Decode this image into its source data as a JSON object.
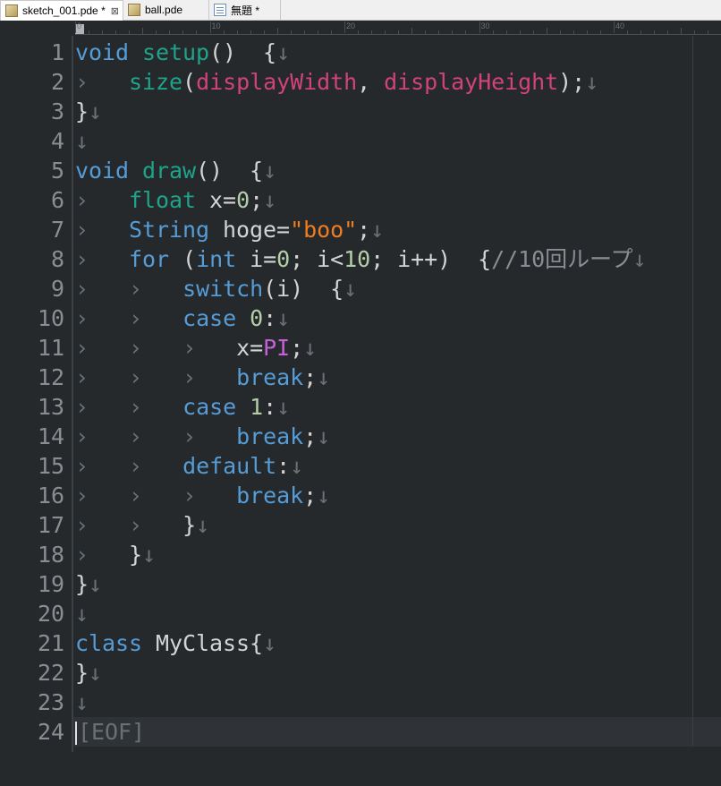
{
  "tabs": [
    {
      "label": "sketch_001.pde *",
      "icon": "pde-file-icon",
      "active": true,
      "close": "⊠"
    },
    {
      "label": "ball.pde",
      "icon": "pde-file-icon",
      "active": false
    },
    {
      "label": "無題 *",
      "icon": "text-file-icon",
      "active": false
    }
  ],
  "ruler": {
    "labels": [
      "0",
      "10",
      "20",
      "30",
      "40"
    ]
  },
  "marks": {
    "tab": "›",
    "newline": "↓",
    "eof": "[EOF]"
  },
  "lines": [
    {
      "n": "1",
      "tokens": [
        [
          "kw",
          "void"
        ],
        [
          "sym",
          " "
        ],
        [
          "fn",
          "setup"
        ],
        [
          "sym",
          "()  {"
        ]
      ],
      "nl": true
    },
    {
      "n": "2",
      "tokens": [
        [
          "tab",
          "›"
        ],
        [
          "sym",
          "   "
        ],
        [
          "fn",
          "size"
        ],
        [
          "sym",
          "("
        ],
        [
          "pink",
          "displayWidth"
        ],
        [
          "sym",
          ", "
        ],
        [
          "pink",
          "displayHeight"
        ],
        [
          "sym",
          ");"
        ]
      ],
      "nl": true
    },
    {
      "n": "3",
      "tokens": [
        [
          "sym",
          "}"
        ]
      ],
      "nl": true
    },
    {
      "n": "4",
      "tokens": [],
      "nl": true
    },
    {
      "n": "5",
      "tokens": [
        [
          "kw",
          "void"
        ],
        [
          "sym",
          " "
        ],
        [
          "fn",
          "draw"
        ],
        [
          "sym",
          "()  {"
        ]
      ],
      "nl": true
    },
    {
      "n": "6",
      "tokens": [
        [
          "tab",
          "›"
        ],
        [
          "sym",
          "   "
        ],
        [
          "type",
          "float"
        ],
        [
          "sym",
          " x="
        ],
        [
          "num",
          "0"
        ],
        [
          "sym",
          ";"
        ]
      ],
      "nl": true
    },
    {
      "n": "7",
      "tokens": [
        [
          "tab",
          "›"
        ],
        [
          "sym",
          "   "
        ],
        [
          "cls",
          "String"
        ],
        [
          "sym",
          " hoge="
        ],
        [
          "str",
          "\"boo\""
        ],
        [
          "sym",
          ";"
        ]
      ],
      "nl": true
    },
    {
      "n": "8",
      "tokens": [
        [
          "tab",
          "›"
        ],
        [
          "sym",
          "   "
        ],
        [
          "kw",
          "for"
        ],
        [
          "sym",
          " ("
        ],
        [
          "kw",
          "int"
        ],
        [
          "sym",
          " i="
        ],
        [
          "num",
          "0"
        ],
        [
          "sym",
          "; i<"
        ],
        [
          "num",
          "10"
        ],
        [
          "sym",
          "; i++)  {"
        ],
        [
          "cmt",
          "//10回ループ"
        ]
      ],
      "nl": true
    },
    {
      "n": "9",
      "tokens": [
        [
          "tab",
          "›"
        ],
        [
          "sym",
          "   "
        ],
        [
          "tab",
          "›"
        ],
        [
          "sym",
          "   "
        ],
        [
          "kw",
          "switch"
        ],
        [
          "sym",
          "(i)  {"
        ]
      ],
      "nl": true
    },
    {
      "n": "10",
      "tokens": [
        [
          "tab",
          "›"
        ],
        [
          "sym",
          "   "
        ],
        [
          "tab",
          "›"
        ],
        [
          "sym",
          "   "
        ],
        [
          "kw",
          "case"
        ],
        [
          "sym",
          " "
        ],
        [
          "num",
          "0"
        ],
        [
          "sym",
          ":"
        ]
      ],
      "nl": true
    },
    {
      "n": "11",
      "tokens": [
        [
          "tab",
          "›"
        ],
        [
          "sym",
          "   "
        ],
        [
          "tab",
          "›"
        ],
        [
          "sym",
          "   "
        ],
        [
          "tab",
          "›"
        ],
        [
          "sym",
          "   "
        ],
        [
          "sym",
          "x="
        ],
        [
          "const",
          "PI"
        ],
        [
          "sym",
          ";"
        ]
      ],
      "nl": true
    },
    {
      "n": "12",
      "tokens": [
        [
          "tab",
          "›"
        ],
        [
          "sym",
          "   "
        ],
        [
          "tab",
          "›"
        ],
        [
          "sym",
          "   "
        ],
        [
          "tab",
          "›"
        ],
        [
          "sym",
          "   "
        ],
        [
          "kw",
          "break"
        ],
        [
          "sym",
          ";"
        ]
      ],
      "nl": true
    },
    {
      "n": "13",
      "tokens": [
        [
          "tab",
          "›"
        ],
        [
          "sym",
          "   "
        ],
        [
          "tab",
          "›"
        ],
        [
          "sym",
          "   "
        ],
        [
          "kw",
          "case"
        ],
        [
          "sym",
          " "
        ],
        [
          "num",
          "1"
        ],
        [
          "sym",
          ":"
        ]
      ],
      "nl": true
    },
    {
      "n": "14",
      "tokens": [
        [
          "tab",
          "›"
        ],
        [
          "sym",
          "   "
        ],
        [
          "tab",
          "›"
        ],
        [
          "sym",
          "   "
        ],
        [
          "tab",
          "›"
        ],
        [
          "sym",
          "   "
        ],
        [
          "kw",
          "break"
        ],
        [
          "sym",
          ";"
        ]
      ],
      "nl": true
    },
    {
      "n": "15",
      "tokens": [
        [
          "tab",
          "›"
        ],
        [
          "sym",
          "   "
        ],
        [
          "tab",
          "›"
        ],
        [
          "sym",
          "   "
        ],
        [
          "kw",
          "default"
        ],
        [
          "sym",
          ":"
        ]
      ],
      "nl": true
    },
    {
      "n": "16",
      "tokens": [
        [
          "tab",
          "›"
        ],
        [
          "sym",
          "   "
        ],
        [
          "tab",
          "›"
        ],
        [
          "sym",
          "   "
        ],
        [
          "tab",
          "›"
        ],
        [
          "sym",
          "   "
        ],
        [
          "kw",
          "break"
        ],
        [
          "sym",
          ";"
        ]
      ],
      "nl": true
    },
    {
      "n": "17",
      "tokens": [
        [
          "tab",
          "›"
        ],
        [
          "sym",
          "   "
        ],
        [
          "tab",
          "›"
        ],
        [
          "sym",
          "   "
        ],
        [
          "sym",
          "}"
        ]
      ],
      "nl": true
    },
    {
      "n": "18",
      "tokens": [
        [
          "tab",
          "›"
        ],
        [
          "sym",
          "   "
        ],
        [
          "sym",
          "}"
        ]
      ],
      "nl": true
    },
    {
      "n": "19",
      "tokens": [
        [
          "sym",
          "}"
        ]
      ],
      "nl": true
    },
    {
      "n": "20",
      "tokens": [],
      "nl": true
    },
    {
      "n": "21",
      "tokens": [
        [
          "kw",
          "class"
        ],
        [
          "sym",
          " MyClass{"
        ]
      ],
      "nl": true
    },
    {
      "n": "22",
      "tokens": [
        [
          "sym",
          "}"
        ]
      ],
      "nl": true
    },
    {
      "n": "23",
      "tokens": [],
      "nl": true
    },
    {
      "n": "24",
      "tokens": [
        [
          "caret",
          ""
        ],
        [
          "eof",
          "[EOF]"
        ]
      ],
      "nl": false
    }
  ]
}
